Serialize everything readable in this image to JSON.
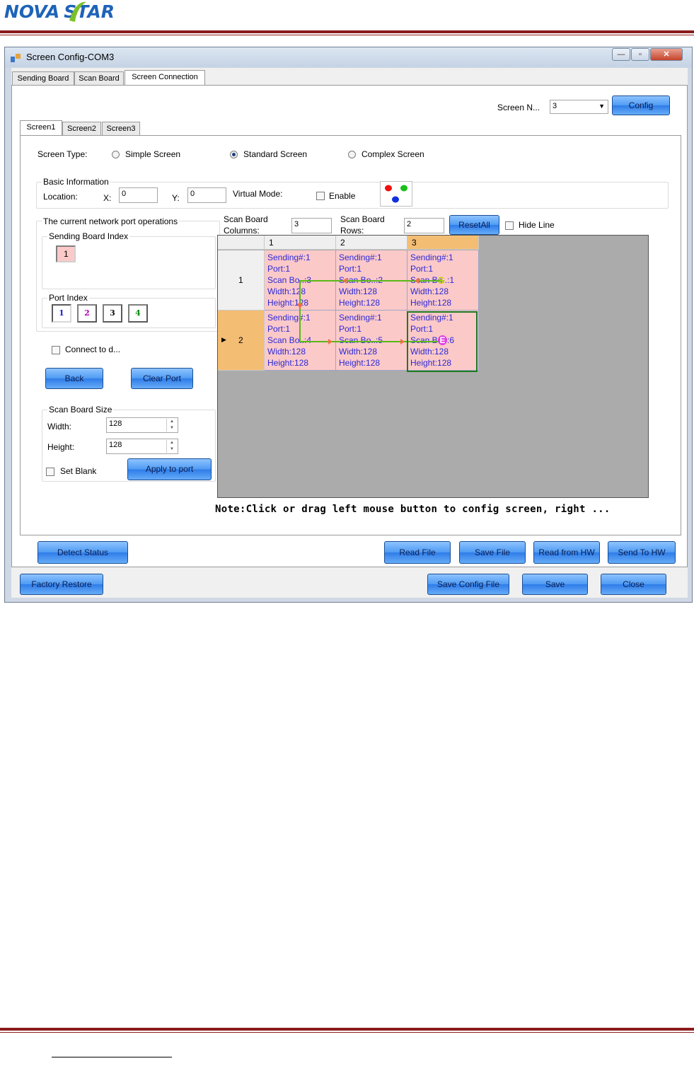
{
  "brand": {
    "nova": "NOVA",
    "star": "STAR"
  },
  "window": {
    "title": "Screen Config-COM3",
    "min_glyph": "—",
    "max_glyph": "▫",
    "close_glyph": "✕"
  },
  "tabs": [
    "Sending Board",
    "Scan Board",
    "Screen Connection"
  ],
  "screen_selector": {
    "label": "Screen N...",
    "value": "3",
    "config_button": "Config"
  },
  "screen_tabs": [
    "Screen1",
    "Screen2",
    "Screen3"
  ],
  "screen_type": {
    "label": "Screen Type:",
    "options": [
      "Simple Screen",
      "Standard Screen",
      "Complex Screen"
    ],
    "selected": "Standard Screen"
  },
  "basic_info": {
    "title": "Basic Information",
    "location_label": "Location:",
    "x_label": "X:",
    "x_value": "0",
    "y_label": "Y:",
    "y_value": "0",
    "virtual_mode_label": "Virtual Mode:",
    "enable_label": "Enable"
  },
  "port_ops": {
    "title": "The current network port operations",
    "sending_board_index_label": "Sending Board Index",
    "sending_board_index": "1",
    "port_index_label": "Port Index",
    "ports": [
      "1",
      "2",
      "3",
      "4"
    ],
    "port_colors": [
      "#1a1ad6",
      "#b000b0",
      "#111111",
      "#0a8a0a"
    ]
  },
  "connect_label": "Connect to d...",
  "back_button": "Back",
  "clear_port_button": "Clear Port",
  "scan_board_size": {
    "title": "Scan Board Size",
    "width_label": "Width:",
    "width_value": "128",
    "height_label": "Height:",
    "height_value": "128",
    "set_blank_label": "Set Blank",
    "apply_button": "Apply to port"
  },
  "scan_board_columns": {
    "label1": "Scan Board",
    "label2": "Columns:",
    "value": "3"
  },
  "scan_board_rows": {
    "label1": "Scan Board",
    "label2": "Rows:",
    "value": "2"
  },
  "reset_all_button": "ResetAll",
  "hide_line_label": "Hide Line",
  "grid": {
    "columns": [
      "1",
      "2",
      "3"
    ],
    "rows": [
      "1",
      "2"
    ],
    "current_row_marker": "▶",
    "cells": [
      [
        [
          "Sending#:1",
          "Port:1",
          "Scan Bo..:3",
          "Width:128",
          "Height:128"
        ],
        [
          "Sending#:1",
          "Port:1",
          "Scan Bo..:2",
          "Width:128",
          "Height:128"
        ],
        [
          "Sending#:1",
          "Port:1",
          "Scan Bo..:1",
          "Width:128",
          "Height:128"
        ]
      ],
      [
        [
          "Sending#:1",
          "Port:1",
          "Scan Bo..:4",
          "Width:128",
          "Height:128"
        ],
        [
          "Sending#:1",
          "Port:1",
          "Scan Bo..:5",
          "Width:128",
          "Height:128"
        ],
        [
          "Sending#:1",
          "Port:1",
          "Scan Bo..:6",
          "Width:128",
          "Height:128"
        ]
      ]
    ],
    "start_marker": "S",
    "end_marker": "E"
  },
  "note": "Note:Click or drag left mouse button to config screen, right ...",
  "bottom_buttons": {
    "detect": "Detect Status",
    "read_file": "Read File",
    "save_file": "Save File",
    "read_hw": "Read from HW",
    "send_hw": "Send To HW"
  },
  "footer_buttons": {
    "factory": "Factory Restore",
    "save_config": "Save Config File",
    "save": "Save",
    "close": "Close"
  }
}
